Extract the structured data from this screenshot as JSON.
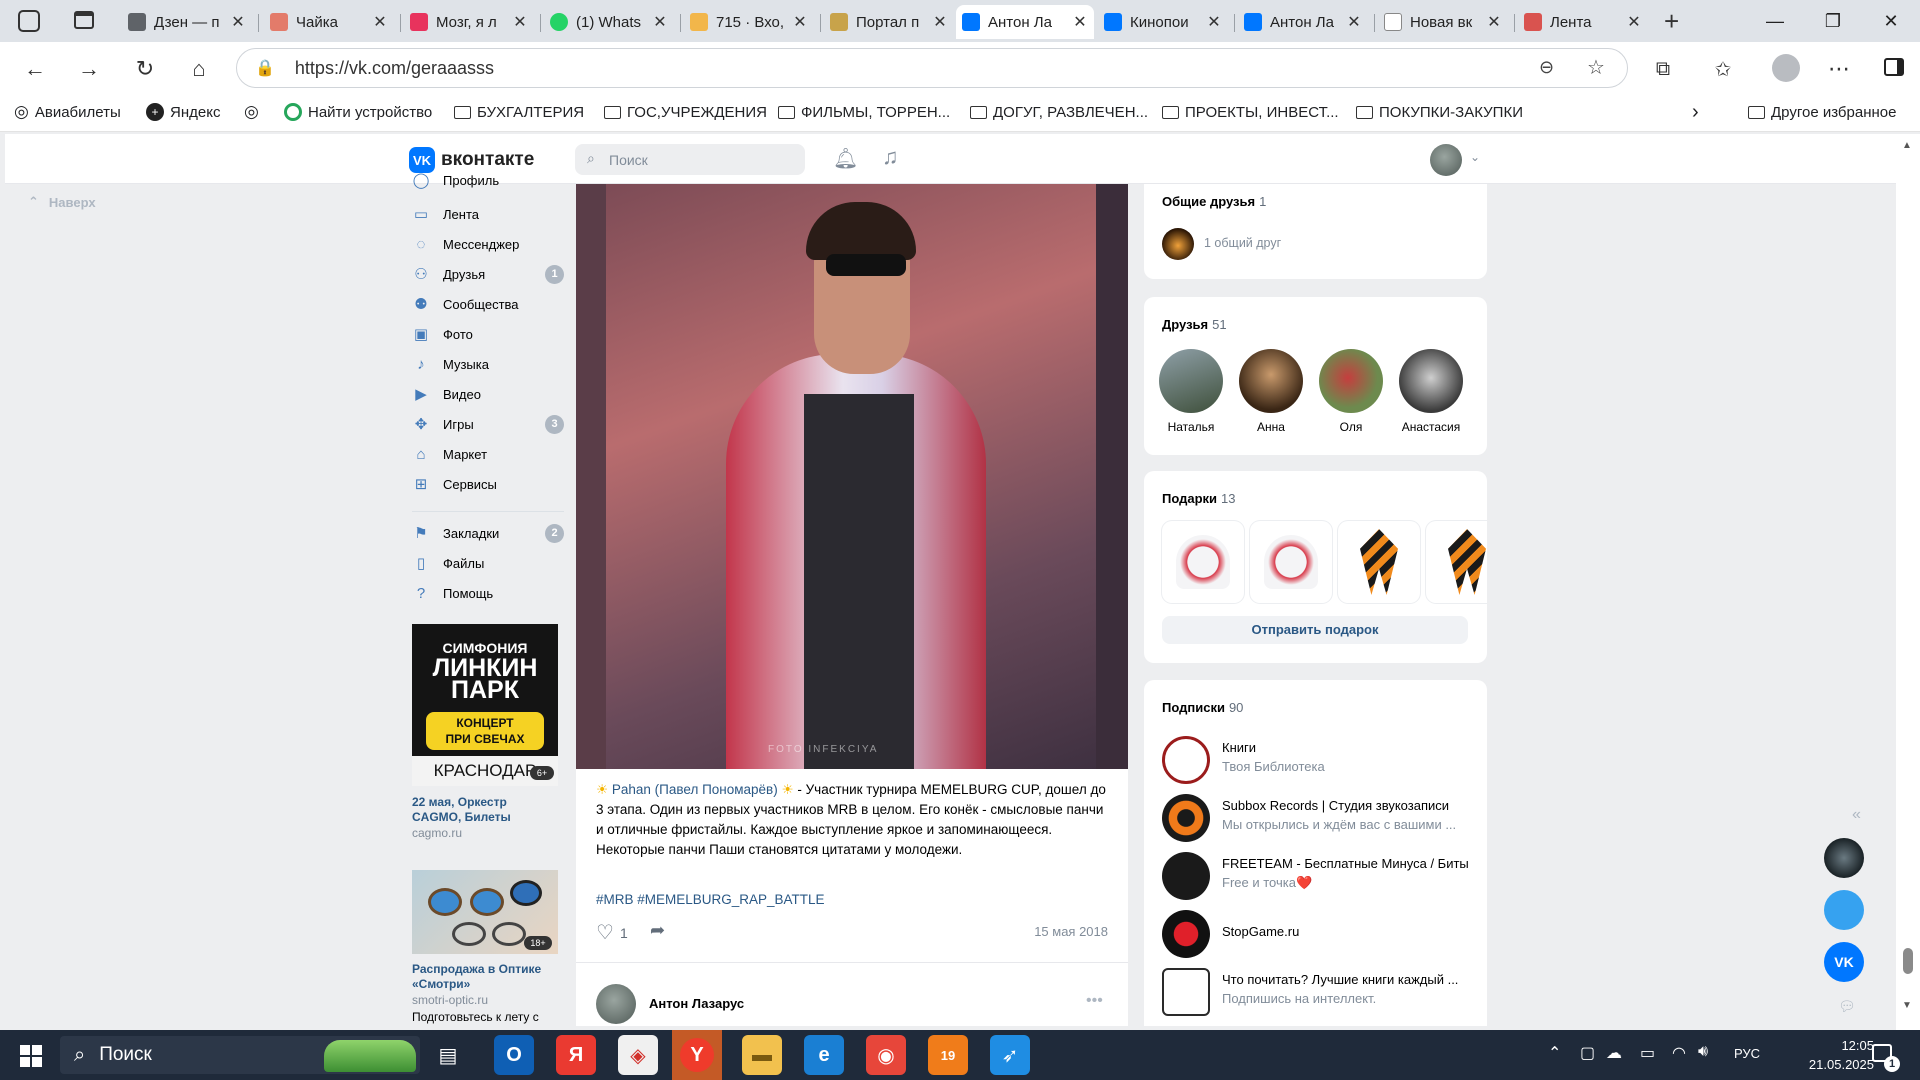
{
  "browser": {
    "tabs": [
      {
        "label": "Дзен — п",
        "fav": "#5f6368",
        "active": false
      },
      {
        "label": "Чайка",
        "fav": "#e37b6a",
        "active": false
      },
      {
        "label": "Мозг, я л",
        "fav": "#e8335d",
        "active": false
      },
      {
        "label": "(1) Whats",
        "fav": "#25d366",
        "active": false
      },
      {
        "label": "715 · Вхо,",
        "fav": "#f2b64a",
        "active": false
      },
      {
        "label": "Портал п",
        "fav": "#c8a34a",
        "active": false
      },
      {
        "label": "Антон Ла",
        "fav": "#0077ff",
        "active": true
      },
      {
        "label": "Кинопои",
        "fav": "#0077ff",
        "active": false
      },
      {
        "label": "Антон Ла",
        "fav": "#0077ff",
        "active": false
      },
      {
        "label": "Новая вк",
        "fav": "#888888",
        "active": false
      },
      {
        "label": "Лента",
        "fav": "#d9534f",
        "active": false
      }
    ],
    "url": "https://vk.com/geraaasss"
  },
  "bookmarks": {
    "items": [
      "Авиабилеты",
      "Яндекс",
      "",
      "Найти устройство",
      "БУХГАЛТЕРИЯ",
      "ГОС,УЧРЕЖДЕНИЯ",
      "ФИЛЬМЫ, ТОРРЕН...",
      "ДОГУГ, РАЗВЛЕЧЕН...",
      "ПРОЕКТЫ, ИНВЕСТ...",
      "ПОКУПКИ-ЗАКУПКИ"
    ],
    "other": "Другое избранное"
  },
  "vk": {
    "brand": "вконтакте",
    "search_placeholder": "Поиск",
    "back_top": "Наверх"
  },
  "menu": {
    "items": [
      {
        "label": "Профиль",
        "icon": "user-icon",
        "count": ""
      },
      {
        "label": "Лента",
        "icon": "feed-icon",
        "count": ""
      },
      {
        "label": "Мессенджер",
        "icon": "message-icon",
        "count": ""
      },
      {
        "label": "Друзья",
        "icon": "friends-icon",
        "count": "1"
      },
      {
        "label": "Сообщества",
        "icon": "groups-icon",
        "count": ""
      },
      {
        "label": "Фото",
        "icon": "photo-icon",
        "count": ""
      },
      {
        "label": "Музыка",
        "icon": "music-icon",
        "count": ""
      },
      {
        "label": "Видео",
        "icon": "video-icon",
        "count": ""
      },
      {
        "label": "Игры",
        "icon": "games-icon",
        "count": "3"
      },
      {
        "label": "Маркет",
        "icon": "market-icon",
        "count": ""
      },
      {
        "label": "Сервисы",
        "icon": "services-icon",
        "count": ""
      }
    ],
    "items2": [
      {
        "label": "Закладки",
        "icon": "bookmark-icon",
        "count": "2"
      },
      {
        "label": "Файлы",
        "icon": "file-icon",
        "count": ""
      },
      {
        "label": "Помощь",
        "icon": "help-icon",
        "count": ""
      }
    ]
  },
  "ads": [
    {
      "title": "22 мая, Оркестр CAGMO, Билеты",
      "domain": "cagmo.ru",
      "l1": "СИМФОНИЯ",
      "l2": "ЛИНКИН",
      "l3": "ПАРК",
      "btn1": "КОНЦЕРТ",
      "btn2": "ПРИ СВЕЧАХ",
      "city": "КРАСНОДАР",
      "age": "6+"
    },
    {
      "title": "Распродажа в Оптике «Смотри»",
      "domain": "smotri-optic.ru",
      "desc": "Подготовьтесь к лету с",
      "age": "18+"
    }
  ],
  "post": {
    "text_link": "Pahan (Павел Пономарёв)",
    "text_body": " - Участник турнира MEMELBURG CUP, дошел до 3 этапа. Один из первых участников MRB в целом. Его конёк - смысловые панчи и отличные фристайлы. Каждое выступление яркое и запоминающееся. Некоторые панчи Паши становятся цитатами у молодежи.",
    "tags": "#MRB #MEMELBURG_RAP_BATTLE",
    "likes": "1",
    "date": "15 мая 2018",
    "next_author": "Антон Лазарус"
  },
  "right": {
    "mutual": {
      "title": "Общие друзья",
      "count": "1",
      "text": "1 общий друг"
    },
    "friends": {
      "title": "Друзья",
      "count": "51",
      "items": [
        "Наталья",
        "Анна",
        "Оля",
        "Анастасия"
      ]
    },
    "gifts": {
      "title": "Подарки",
      "count": "13",
      "button": "Отправить подарок"
    },
    "subs": {
      "title": "Подписки",
      "count": "90",
      "items": [
        {
          "name": "Книги",
          "desc": "Твоя Библиотека"
        },
        {
          "name": "Subbox Records | Студия звукозаписи",
          "desc": "Мы открылись и ждём вас с вашими ..."
        },
        {
          "name": "FREETEAM - Бесплатные Минуса / Биты",
          "desc": "Free и точка❤️"
        },
        {
          "name": "StopGame.ru",
          "desc": ""
        },
        {
          "name": "Что почитать? Лучшие книги каждый ...",
          "desc": "Подпишись на интеллект."
        }
      ]
    }
  },
  "taskbar": {
    "search": "Поиск",
    "lang": "РУС",
    "time": "12:05",
    "date": "21.05.2025",
    "notif": "1"
  },
  "colors": {
    "vk_blue": "#0077ff",
    "link": "#2a5885"
  }
}
